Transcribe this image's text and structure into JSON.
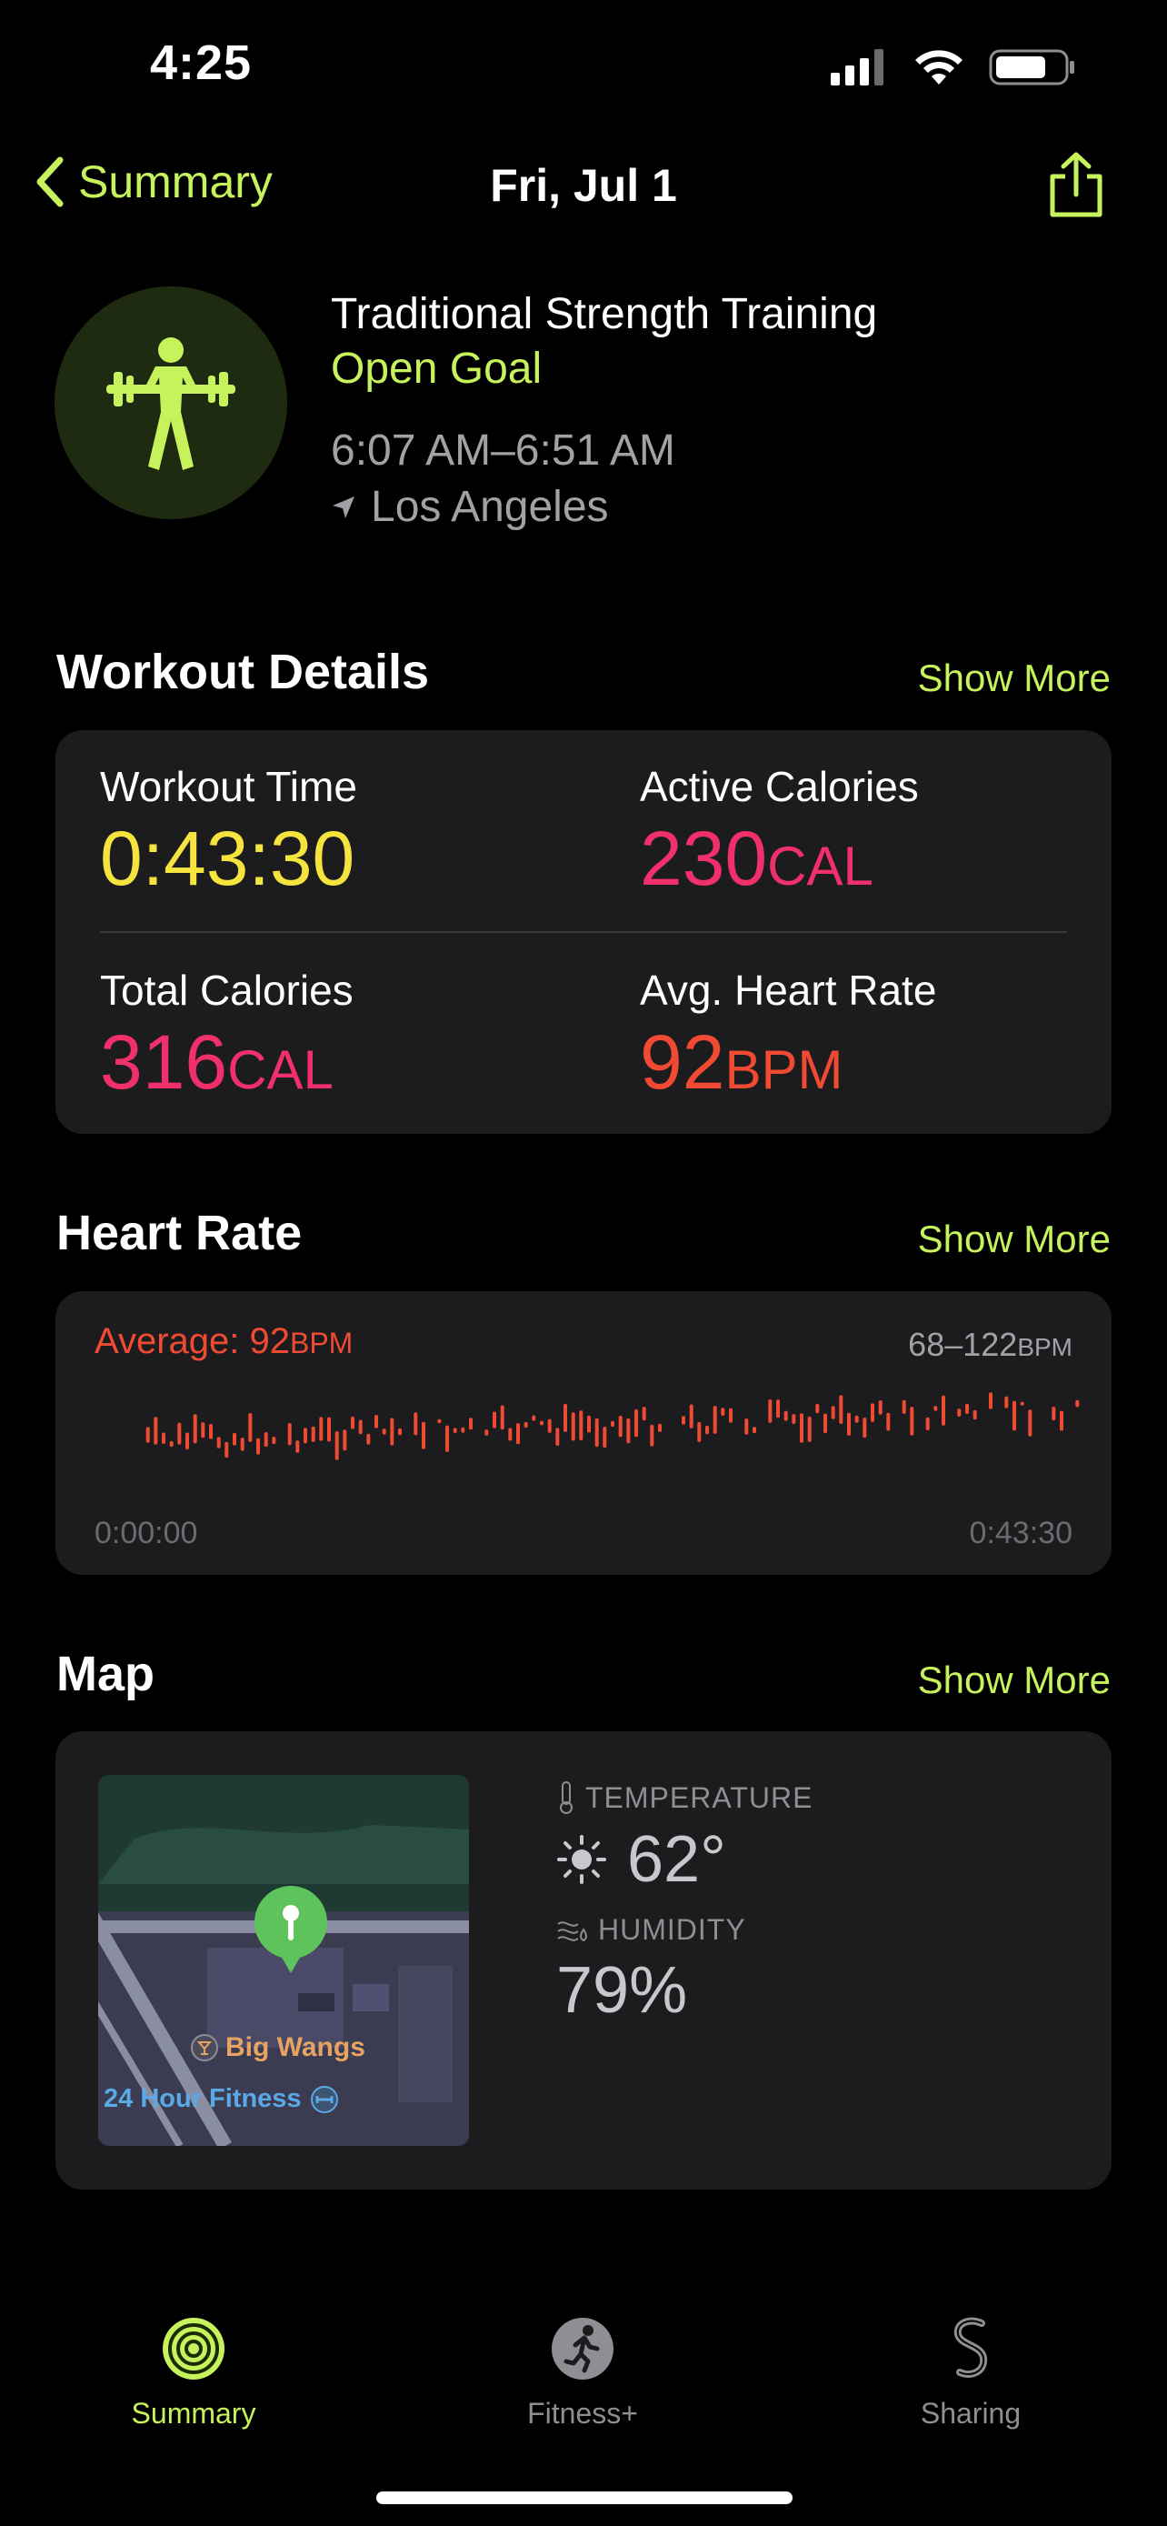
{
  "status_bar": {
    "time": "4:25"
  },
  "nav": {
    "back_label": "Summary",
    "title": "Fri, Jul 1"
  },
  "workout": {
    "title": "Traditional Strength Training",
    "goal": "Open Goal",
    "time_range": "6:07 AM–6:51 AM",
    "location": "Los Angeles"
  },
  "sections": {
    "details_title": "Workout Details",
    "heart_title": "Heart Rate",
    "map_title": "Map",
    "show_more": "Show More"
  },
  "details": {
    "workout_time_label": "Workout Time",
    "workout_time_value": "0:43:30",
    "active_cal_label": "Active Calories",
    "active_cal_value": "230",
    "active_cal_unit": "CAL",
    "total_cal_label": "Total Calories",
    "total_cal_value": "316",
    "total_cal_unit": "CAL",
    "avg_hr_label": "Avg. Heart Rate",
    "avg_hr_value": "92",
    "avg_hr_unit": "BPM"
  },
  "heart_rate": {
    "average_label": "Average: 92",
    "average_unit": "BPM",
    "range": "68–122",
    "range_unit": "BPM",
    "start_time": "0:00:00",
    "end_time": "0:43:30",
    "color": "#f04a32"
  },
  "map_card": {
    "place_1": "Big Wangs",
    "place_2": "24 Hour Fitness",
    "temperature_label": "TEMPERATURE",
    "temperature_value": "62°",
    "humidity_label": "HUMIDITY",
    "humidity_value": "79%"
  },
  "tabs": [
    {
      "label": "Summary",
      "icon": "activity-rings-icon",
      "active": true
    },
    {
      "label": "Fitness+",
      "icon": "runner-icon",
      "active": false
    },
    {
      "label": "Sharing",
      "icon": "sharing-icon",
      "active": false
    }
  ],
  "colors": {
    "accent": "#c6f25b",
    "yellow": "#f5e33e",
    "pink": "#f0306a",
    "red": "#f04a32"
  }
}
